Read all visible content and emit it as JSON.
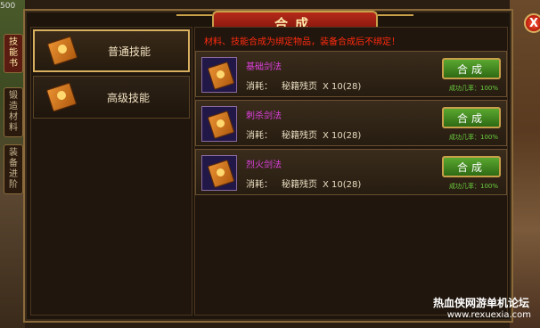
{
  "background": {
    "top_left_value": "500"
  },
  "window": {
    "title": "合成",
    "close_label": "X"
  },
  "side_tabs": [
    {
      "label": [
        "技",
        "能",
        "书"
      ],
      "active": true
    },
    {
      "label": [
        "锻",
        "造",
        "材",
        "料"
      ],
      "active": false
    },
    {
      "label": [
        "装",
        "备",
        "进",
        "阶"
      ],
      "active": false
    }
  ],
  "categories": [
    {
      "label": "普通技能",
      "selected": true
    },
    {
      "label": "高级技能",
      "selected": false
    }
  ],
  "notice": "材料、技能合成为绑定物品，装备合成后不绑定！",
  "recipes": [
    {
      "name": "基础剑法",
      "consume_label": "消耗：",
      "material": "秘籍残页",
      "count": "X  10(28)",
      "button": "合成",
      "rate": "成功几率：100%"
    },
    {
      "name": "刺杀剑法",
      "consume_label": "消耗：",
      "material": "秘籍残页",
      "count": "X  10(28)",
      "button": "合成",
      "rate": "成功几率：100%"
    },
    {
      "name": "烈火剑法",
      "consume_label": "消耗：",
      "material": "秘籍残页",
      "count": "X  10(28)",
      "button": "合成",
      "rate": "成功几率：100%"
    }
  ],
  "watermark": {
    "line1": "热血侠网游单机论坛",
    "line2": "www.rexuexia.com"
  },
  "colors": {
    "accent_gold": "#d8b060",
    "title_red": "#b52a1a",
    "notice_red": "#ff2a10",
    "skill_name_magenta": "#e040e0",
    "button_green": "#5aa830"
  }
}
